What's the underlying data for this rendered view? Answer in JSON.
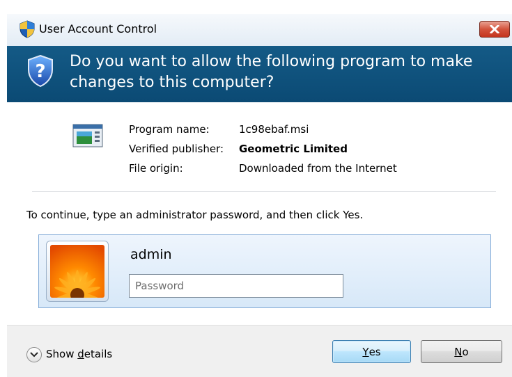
{
  "window": {
    "title": "User Account Control"
  },
  "banner": {
    "question": "Do you want to allow the following program to make changes to this computer?"
  },
  "program": {
    "name_label": "Program name:",
    "name_value": "1c98ebaf.msi",
    "publisher_label": "Verified publisher:",
    "publisher_value": "Geometric Limited",
    "origin_label": "File origin:",
    "origin_value": "Downloaded from the Internet"
  },
  "instruction": "To continue, type an administrator password, and then click Yes.",
  "credential": {
    "username": "admin",
    "password_placeholder": "Password",
    "password_value": ""
  },
  "footer": {
    "show_details_prefix": "Show ",
    "show_details_accel": "d",
    "show_details_suffix": "etails"
  },
  "buttons": {
    "yes_accel": "Y",
    "yes_rest": "es",
    "no_accel": "N",
    "no_rest": "o"
  },
  "colors": {
    "banner": "#0f5280",
    "accent_button": "#bee6fd",
    "close_button": "#d3533c"
  },
  "icons": [
    "uac-shield-icon",
    "question-shield-icon",
    "close-icon",
    "program-icon",
    "chevron-down-icon"
  ]
}
